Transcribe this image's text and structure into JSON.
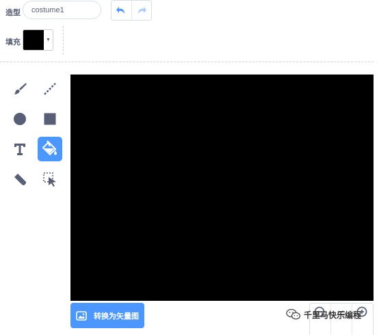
{
  "costume": {
    "label": "造型",
    "name_value": "costume1"
  },
  "history": {
    "undo_icon": "undo-icon",
    "redo_icon": "redo-icon"
  },
  "fill": {
    "label": "填充",
    "color": "#000000"
  },
  "tools": [
    {
      "name": "brush",
      "icon": "brush-icon",
      "selected": false
    },
    {
      "name": "line",
      "icon": "line-icon",
      "selected": false
    },
    {
      "name": "circle",
      "icon": "circle-icon",
      "selected": false
    },
    {
      "name": "rectangle",
      "icon": "rectangle-icon",
      "selected": false
    },
    {
      "name": "text",
      "icon": "text-icon",
      "selected": false
    },
    {
      "name": "fill",
      "icon": "fill-bucket-icon",
      "selected": true
    },
    {
      "name": "eraser",
      "icon": "eraser-icon",
      "selected": false
    },
    {
      "name": "select",
      "icon": "select-icon",
      "selected": false
    }
  ],
  "canvas": {
    "background": "#000000"
  },
  "convert_button": {
    "label": "转换为矢量图",
    "icon": "image-icon"
  },
  "zoom": {
    "zoom_out_icon": "zoom-out-icon",
    "reset_icon": "zoom-reset-icon",
    "zoom_in_icon": "zoom-in-icon"
  },
  "watermark": {
    "text": "千里马快乐编程",
    "icon": "wechat-icon"
  },
  "colors": {
    "accent": "#4c97ff",
    "icon_gray": "#575e75",
    "canvas": "#000000"
  }
}
